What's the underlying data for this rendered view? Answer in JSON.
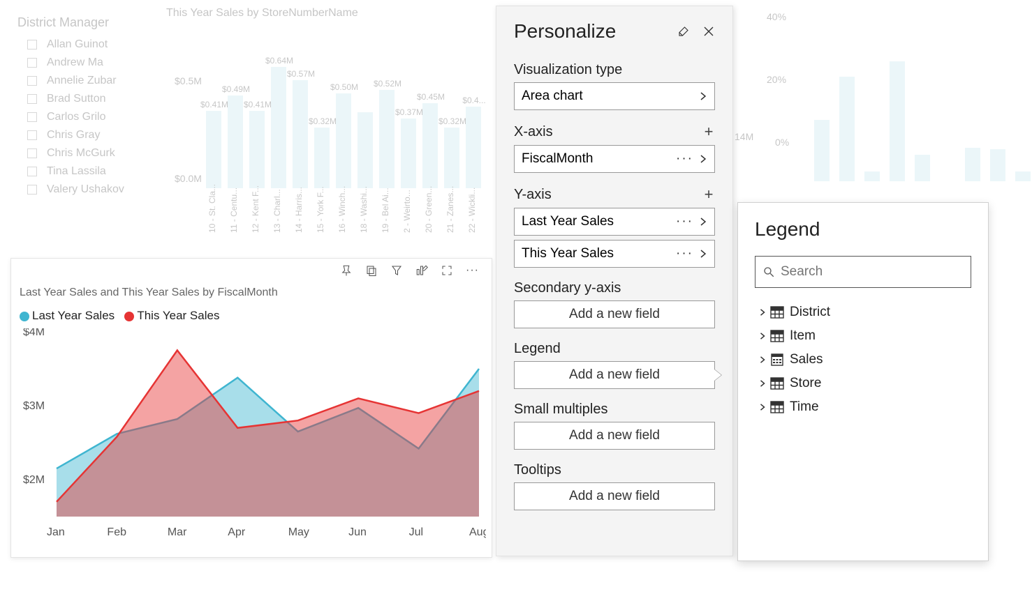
{
  "slicer": {
    "title": "District Manager",
    "items": [
      "Allan Guinot",
      "Andrew Ma",
      "Annelie Zubar",
      "Brad Sutton",
      "Carlos Grilo",
      "Chris Gray",
      "Chris McGurk",
      "Tina Lassila",
      "Valery Ushakov"
    ]
  },
  "bg_bar_chart": {
    "title": "This Year Sales by StoreNumberName",
    "y_ticks": [
      "$0.5M",
      "$0.0M"
    ],
    "bars": [
      {
        "label": "10 - St. Cla...",
        "value": 0.41,
        "text": "$0.41M"
      },
      {
        "label": "11 - Centu...",
        "value": 0.49,
        "text": "$0.49M"
      },
      {
        "label": "12 - Kent F...",
        "value": 0.41,
        "text": "$0.41M"
      },
      {
        "label": "13 - Charl...",
        "value": 0.64,
        "text": "$0.64M"
      },
      {
        "label": "14 - Harris...",
        "value": 0.57,
        "text": "$0.57M"
      },
      {
        "label": "15 - York F...",
        "value": 0.32,
        "text": "$0.32M"
      },
      {
        "label": "16 - Winch...",
        "value": 0.5,
        "text": "$0.50M"
      },
      {
        "label": "18 - Washi...",
        "value": 0.4,
        "text": ""
      },
      {
        "label": "19 - Bel Ai...",
        "value": 0.52,
        "text": "$0.52M"
      },
      {
        "label": "2 - Weirto...",
        "value": 0.37,
        "text": "$0.37M"
      },
      {
        "label": "20 - Green...",
        "value": 0.45,
        "text": "$0.45M"
      },
      {
        "label": "21 - Zanes...",
        "value": 0.32,
        "text": "$0.32M"
      },
      {
        "label": "22 - Wickli...",
        "value": 0.43,
        "text": "$0.4..."
      }
    ]
  },
  "bg_right_chart": {
    "y_ticks": [
      "40%",
      "20%",
      "0%"
    ],
    "data_label": "14M"
  },
  "area_chart": {
    "title": "Last Year Sales and This Year Sales by FiscalMonth",
    "legend": [
      "Last Year Sales",
      "This Year Sales"
    ],
    "colors": {
      "last": "#3fb5d0",
      "this": "#e63434"
    }
  },
  "chart_data": {
    "type": "area",
    "categories": [
      "Jan",
      "Feb",
      "Mar",
      "Apr",
      "May",
      "Jun",
      "Jul",
      "Aug"
    ],
    "series": [
      {
        "name": "Last Year Sales",
        "values": [
          2.15,
          2.62,
          2.82,
          3.38,
          2.65,
          2.97,
          2.42,
          3.5
        ]
      },
      {
        "name": "This Year Sales",
        "values": [
          1.7,
          2.58,
          3.75,
          2.7,
          2.8,
          3.1,
          2.9,
          3.2
        ]
      }
    ],
    "ylabel_prefix": "$",
    "ylabel_suffix": "M",
    "ylim": [
      1.5,
      4.0
    ],
    "y_ticks": [
      2,
      3,
      4
    ]
  },
  "personalize": {
    "title": "Personalize",
    "viz_type_label": "Visualization type",
    "viz_type_value": "Area chart",
    "xaxis_label": "X-axis",
    "xaxis_value": "FiscalMonth",
    "yaxis_label": "Y-axis",
    "yaxis_values": [
      "Last Year Sales",
      "This Year Sales"
    ],
    "secondary_label": "Secondary y-axis",
    "legend_label": "Legend",
    "small_mult_label": "Small multiples",
    "tooltips_label": "Tooltips",
    "add_field_label": "Add a new field"
  },
  "legend_popup": {
    "title": "Legend",
    "search_placeholder": "Search",
    "tables": [
      "District",
      "Item",
      "Sales",
      "Store",
      "Time"
    ]
  }
}
